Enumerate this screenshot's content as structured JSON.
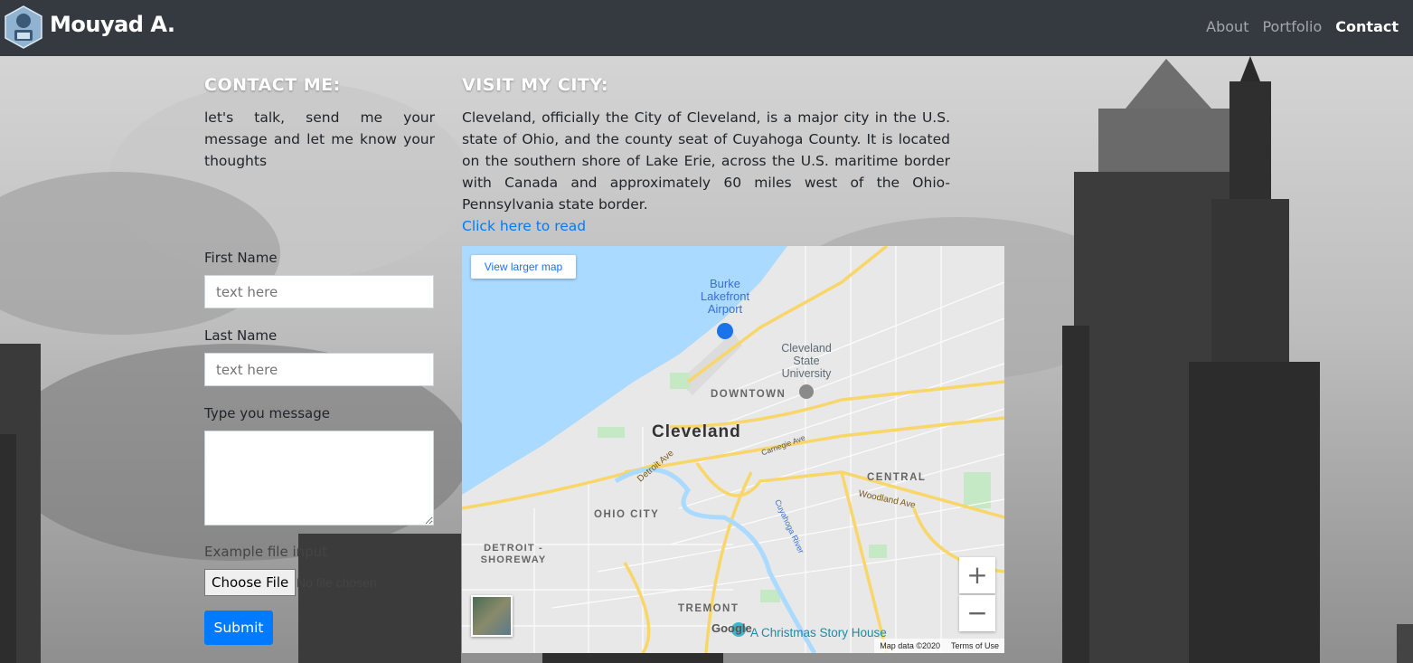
{
  "navbar": {
    "brand": "Mouyad A.",
    "links": [
      {
        "label": "About",
        "active": false
      },
      {
        "label": "Portfolio",
        "active": false
      },
      {
        "label": "Contact",
        "active": true
      }
    ]
  },
  "contact": {
    "title": "CONTACT ME:",
    "intro": "let's talk, send me your message and let me know your thoughts",
    "first_name_label": "First Name",
    "first_name_placeholder": "text here",
    "last_name_label": "Last Name",
    "last_name_placeholder": "text here",
    "message_label": "Type you message",
    "file_label": "Example file input",
    "file_button": "Choose File",
    "file_status": "No file chosen",
    "submit_label": "Submit"
  },
  "city": {
    "title": "VISIT MY CITY:",
    "description": "Cleveland, officially the City of Cleveland, is a major city in the U.S. state of Ohio, and the county seat of Cuyahoga County. It is located on the southern shore of Lake Erie, across the U.S. maritime border with Canada and approximately 60 miles west of the Ohio-Pennsylvania state border.",
    "link": "Click here to read"
  },
  "map": {
    "view_larger": "View larger map",
    "zoom_in": "+",
    "zoom_out": "−",
    "labels": {
      "airport": "Burke Lakefront Airport",
      "university": "Cleveland State University",
      "downtown": "DOWNTOWN",
      "city": "Cleveland",
      "central": "CENTRAL",
      "ohio_city": "OHIO CITY",
      "detroit_shoreway": "DETROIT - SHOREWAY",
      "tremont": "TREMONT",
      "christmas_story": "A Christmas Story House",
      "detroit_ave": "Detroit Ave",
      "woodland_ave": "Woodland Ave",
      "carnegie_ave": "Carnegie Ave",
      "cuyahoga_river": "Cuyahoga River",
      "google": "Google"
    },
    "map_data": "Map data ©2020",
    "terms": "Terms of Use"
  }
}
